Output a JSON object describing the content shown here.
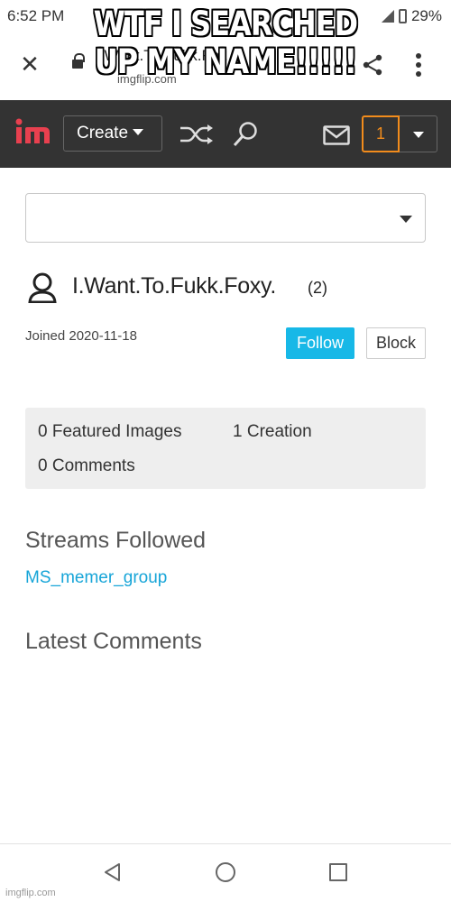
{
  "status_bar": {
    "time": "6:52 PM",
    "battery": "29%"
  },
  "browser": {
    "page_title": "I.Want.To.Fukk.Fo...",
    "domain": "imgflip.com",
    "icons": [
      "close-icon",
      "lock-icon",
      "share-icon",
      "more-icon"
    ]
  },
  "meme": {
    "caption_line1": "WTF I SEARCHED",
    "caption_line2": "UP MY NAME!!!!!"
  },
  "site_nav": {
    "create_label": "Create",
    "notification_count": "1",
    "icons": [
      "imgflip-logo",
      "shuffle-icon",
      "search-icon",
      "mail-icon",
      "chevron-down-icon"
    ],
    "accent_color": "#f28c1c"
  },
  "profile": {
    "dropdown_value": "",
    "username": "I.Want.To.Fukk.Foxy.",
    "count": "(2)",
    "joined": "Joined 2020-11-18",
    "follow_label": "Follow",
    "block_label": "Block",
    "follow_color": "#17b8e7"
  },
  "stats": {
    "featured": "0 Featured Images",
    "creations": "1 Creation",
    "comments": "0 Comments"
  },
  "streams": {
    "title": "Streams Followed",
    "items": [
      "MS_memer_group"
    ]
  },
  "latest_comments": {
    "title": "Latest Comments"
  },
  "watermark": "imgflip.com"
}
